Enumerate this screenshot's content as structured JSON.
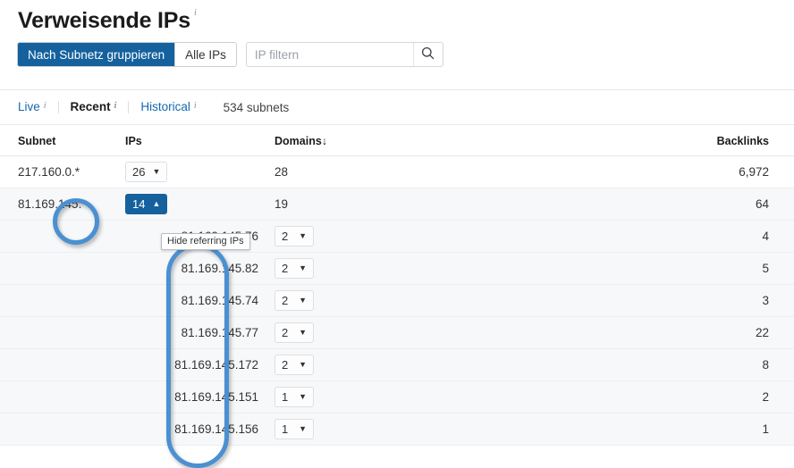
{
  "header": {
    "title": "Verweisende IPs",
    "info_icon": "i"
  },
  "toolbar": {
    "group_by_subnet_label": "Nach Subnetz gruppieren",
    "all_ips_label": "Alle IPs",
    "filter_placeholder": "IP filtern",
    "filter_value": "",
    "search_icon": "search-icon"
  },
  "subtabs": {
    "items": [
      {
        "label": "Live",
        "active": false,
        "info": "i"
      },
      {
        "label": "Recent",
        "active": true,
        "info": "i"
      },
      {
        "label": "Historical",
        "active": false,
        "info": "i"
      }
    ],
    "count_label": "534 subnets"
  },
  "table": {
    "columns": {
      "subnet": "Subnet",
      "ips": "IPs",
      "domains": "Domains",
      "domains_sort_icon": "↓",
      "backlinks": "Backlinks"
    },
    "rows": [
      {
        "type": "subnet",
        "subnet": "217.160.0.*",
        "ips_count": "26",
        "ips_caret": "▼",
        "ips_expanded": false,
        "domains": "28",
        "backlinks": "6,972"
      },
      {
        "type": "subnet",
        "subnet": "81.169.145.*",
        "ips_count": "14",
        "ips_caret": "▲",
        "ips_expanded": true,
        "domains": "19",
        "backlinks": "64"
      },
      {
        "type": "ip",
        "ip": "81.169.145.76",
        "domains": "2",
        "domains_caret": "▼",
        "backlinks": "4"
      },
      {
        "type": "ip",
        "ip": "81.169.145.82",
        "domains": "2",
        "domains_caret": "▼",
        "backlinks": "5"
      },
      {
        "type": "ip",
        "ip": "81.169.145.74",
        "domains": "2",
        "domains_caret": "▼",
        "backlinks": "3"
      },
      {
        "type": "ip",
        "ip": "81.169.145.77",
        "domains": "2",
        "domains_caret": "▼",
        "backlinks": "22"
      },
      {
        "type": "ip",
        "ip": "81.169.145.172",
        "domains": "2",
        "domains_caret": "▼",
        "backlinks": "8"
      },
      {
        "type": "ip",
        "ip": "81.169.145.151",
        "domains": "1",
        "domains_caret": "▼",
        "backlinks": "2"
      },
      {
        "type": "ip",
        "ip": "81.169.145.156",
        "domains": "1",
        "domains_caret": "▼",
        "backlinks": "1"
      }
    ]
  },
  "tooltip": {
    "text": "Hide referring IPs"
  },
  "annotations": {
    "ellipse_target": "subnet-octet-145",
    "capsule_target": "ip-address-column"
  },
  "colors": {
    "accent_blue": "#15619e",
    "link_blue": "#1568b0",
    "annotation_blue": "#4a90d2",
    "row_stripe": "#f7f8fa",
    "border": "#e6e8eb"
  }
}
